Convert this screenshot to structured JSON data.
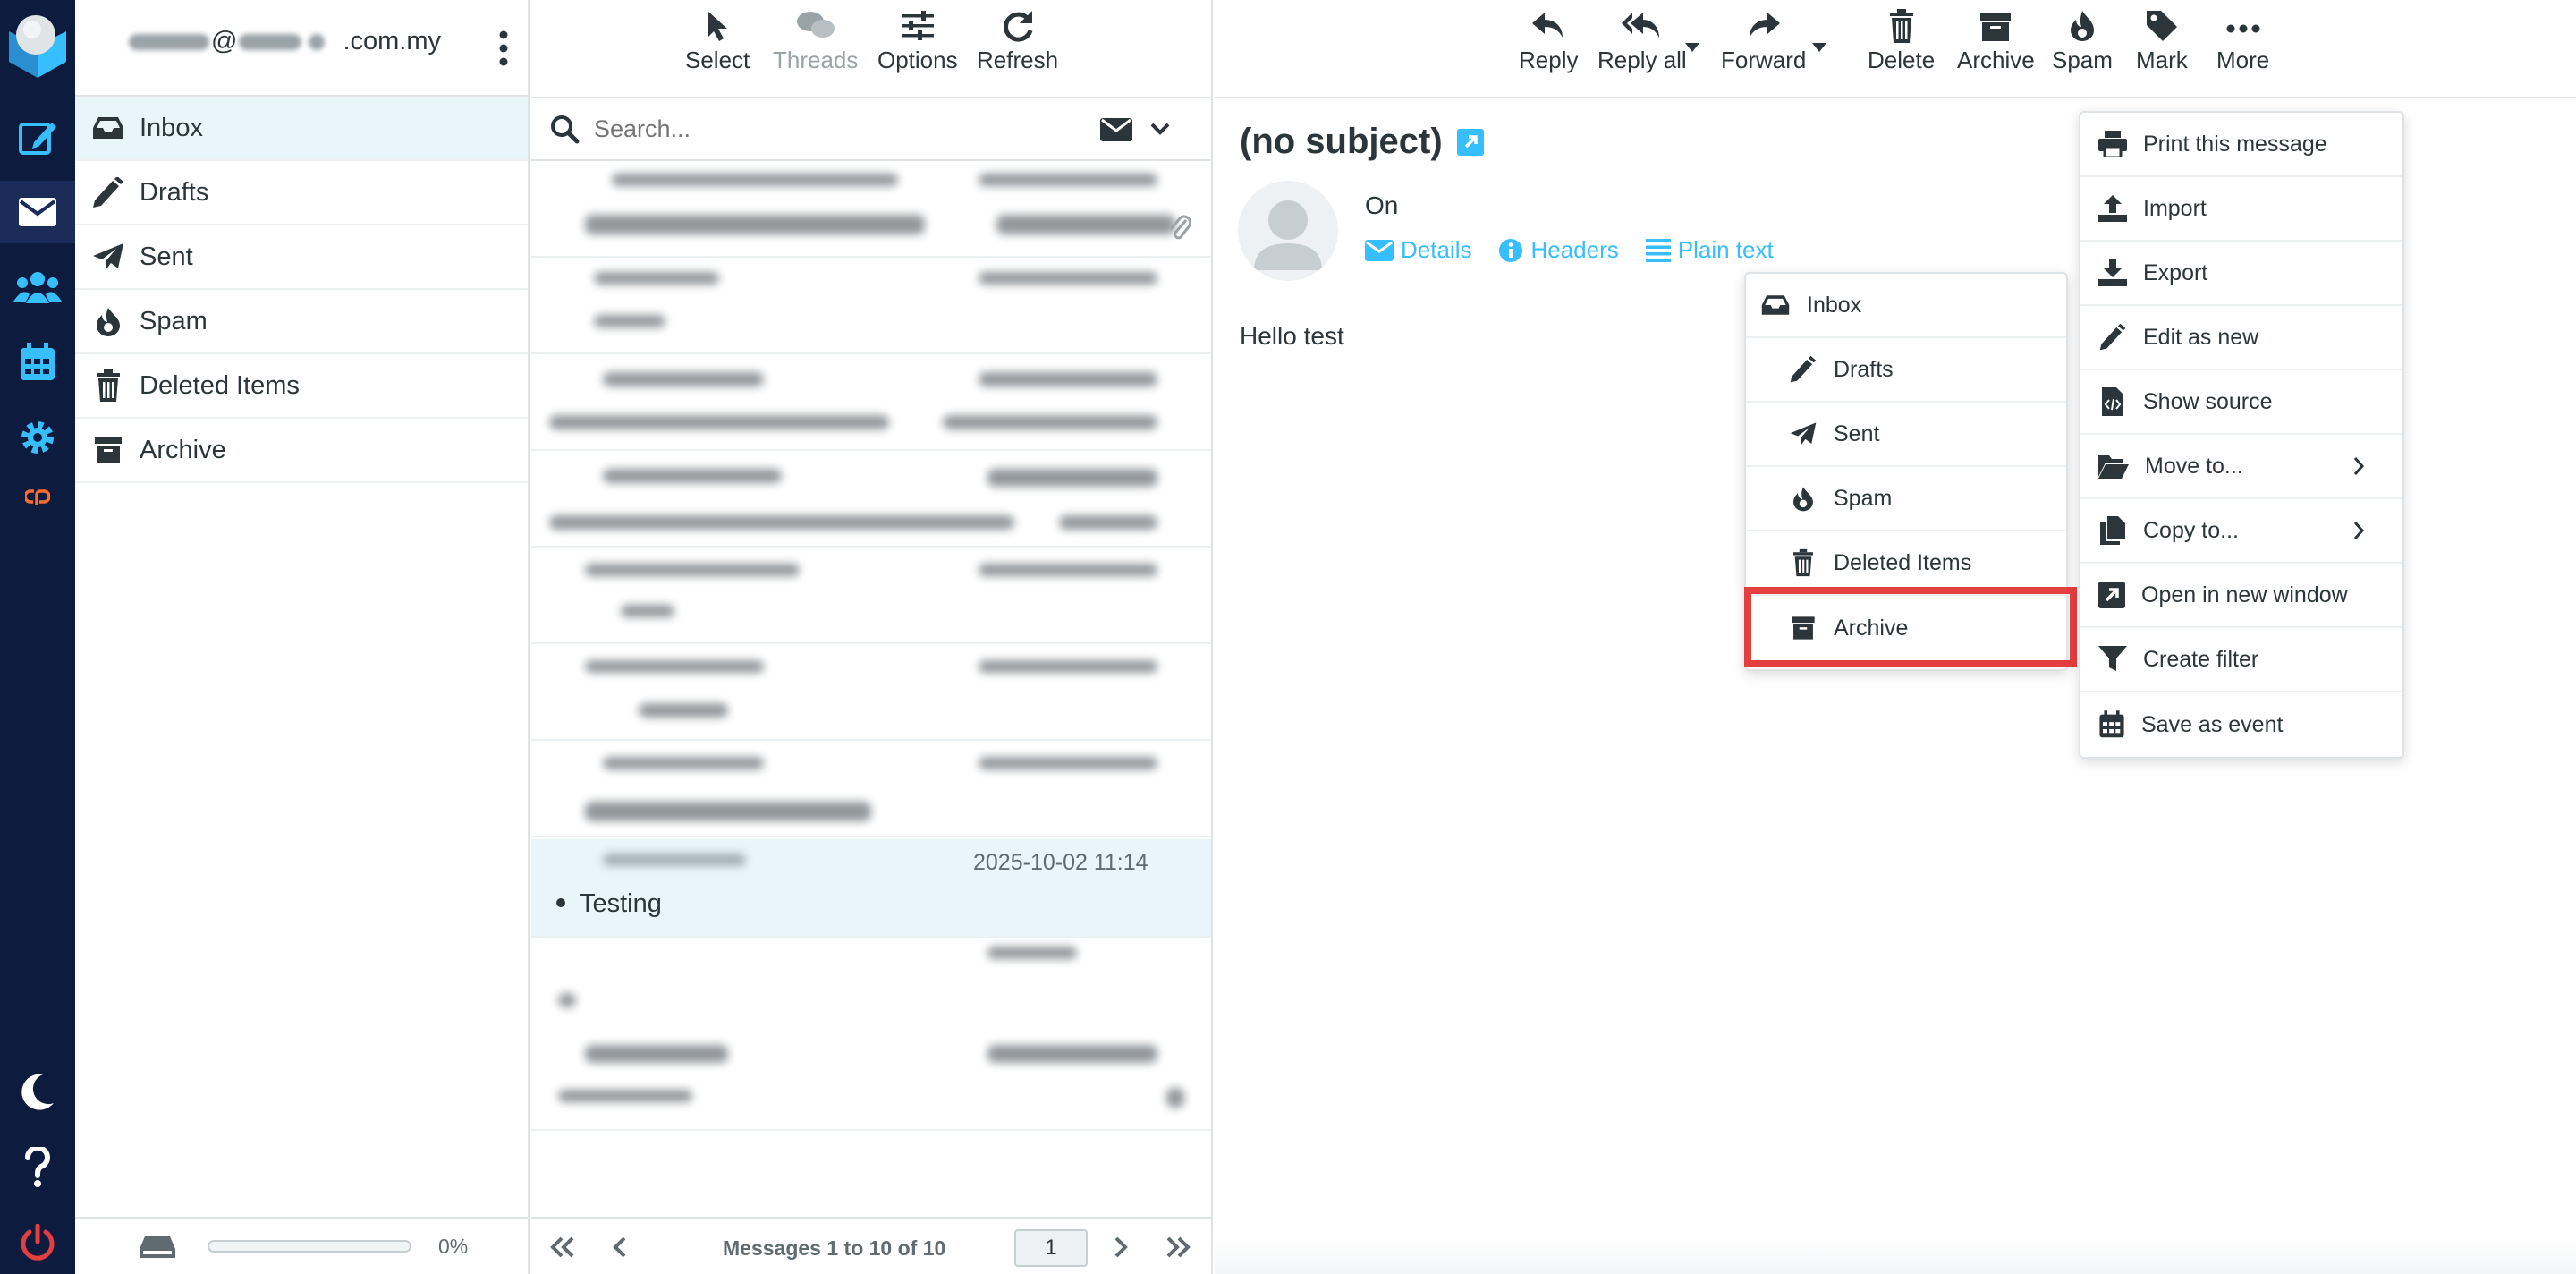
{
  "account": {
    "prefix": "@",
    "suffix": ".com.my"
  },
  "folders": [
    {
      "label": "Inbox",
      "icon": "inbox-icon"
    },
    {
      "label": "Drafts",
      "icon": "pencil-icon"
    },
    {
      "label": "Sent",
      "icon": "paper-plane-icon"
    },
    {
      "label": "Spam",
      "icon": "fire-icon"
    },
    {
      "label": "Deleted Items",
      "icon": "trash-icon"
    },
    {
      "label": "Archive",
      "icon": "archive-icon"
    }
  ],
  "quota": {
    "percent_label": "0%",
    "fill": 0
  },
  "list_toolbar": {
    "select": "Select",
    "threads": "Threads",
    "options": "Options",
    "refresh": "Refresh"
  },
  "search": {
    "placeholder": "Search..."
  },
  "selected_message": {
    "date": "2025-10-02 11:14",
    "subject": "Testing"
  },
  "pager": {
    "label": "Messages 1 to 10 of 10",
    "page": "1"
  },
  "message_toolbar": {
    "reply": "Reply",
    "reply_all": "Reply all",
    "forward": "Forward",
    "delete": "Delete",
    "archive": "Archive",
    "spam": "Spam",
    "mark": "Mark",
    "more": "More"
  },
  "message": {
    "subject": "(no subject)",
    "from_line": "On",
    "details": "Details",
    "headers": "Headers",
    "plain_text": "Plain text",
    "body": "Hello test"
  },
  "more_menu": {
    "print": "Print this message",
    "import": "Import",
    "export": "Export",
    "edit_as_new": "Edit as new",
    "show_source": "Show source",
    "move_to": "Move to...",
    "copy_to": "Copy to...",
    "open_new_window": "Open in new window",
    "create_filter": "Create filter",
    "save_as_event": "Save as event"
  },
  "move_submenu": {
    "inbox": "Inbox",
    "drafts": "Drafts",
    "sent": "Sent",
    "spam": "Spam",
    "deleted": "Deleted Items",
    "archive": "Archive"
  },
  "colors": {
    "accent": "#37beff",
    "nav_bg": "#0d1b3e",
    "highlight": "#e53e3e",
    "logout": "#e53e3e"
  }
}
